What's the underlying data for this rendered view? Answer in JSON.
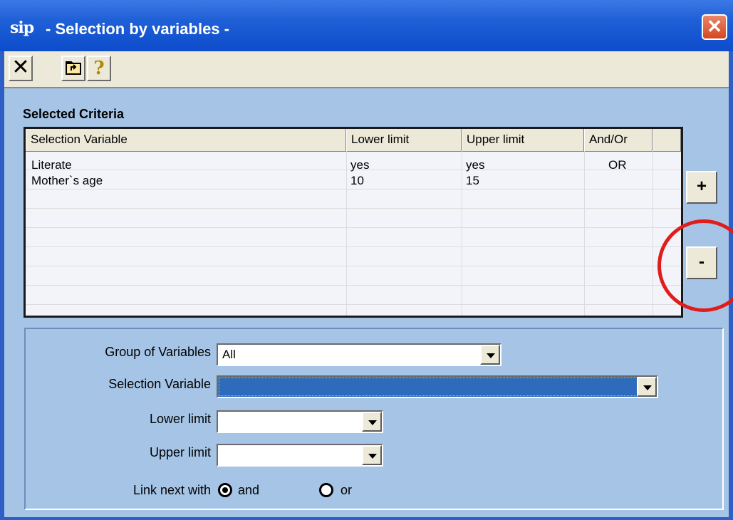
{
  "window": {
    "title": "- Selection by variables -",
    "logo": "sip",
    "close_glyph": "✕"
  },
  "toolbar": {
    "buttons": [
      {
        "name": "close-x-icon",
        "glyph": "✕"
      },
      {
        "name": "folder-up-icon",
        "glyph": ""
      },
      {
        "name": "help-icon",
        "glyph": "?"
      }
    ]
  },
  "criteria": {
    "title": "Selected Criteria",
    "columns": [
      "Selection Variable",
      "Lower limit",
      "Upper limit",
      "And/Or"
    ],
    "rows": [
      {
        "variable": "Literate",
        "lower": "yes",
        "upper": "yes",
        "andor": "OR"
      },
      {
        "variable": "Mother`s age",
        "lower": "10",
        "upper": "15",
        "andor": ""
      }
    ],
    "add_label": "+",
    "remove_label": "-"
  },
  "form": {
    "group_label": "Group of Variables",
    "group_value": "All",
    "variable_label": "Selection Variable",
    "variable_value": "",
    "lower_label": "Lower limit",
    "lower_value": "",
    "upper_label": "Upper limit",
    "upper_value": "",
    "link_label": "Link next with",
    "link_options": [
      "and",
      "or"
    ],
    "link_selected": "and"
  },
  "colors": {
    "highlight_circle": "#e01d1d",
    "panel_bg": "#a6c5e6",
    "titlebar": "#1f5fd6"
  }
}
